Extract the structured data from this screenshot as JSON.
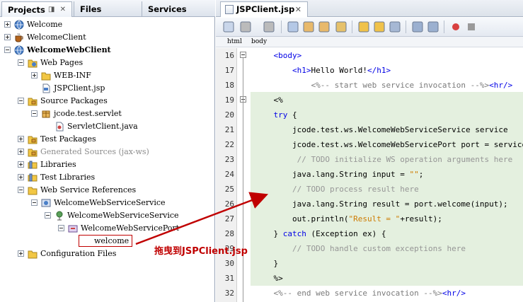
{
  "projects_panel": {
    "tabs": [
      "Projects",
      "Files",
      "Services"
    ],
    "tab_controls": "◨ ✕",
    "tree": [
      {
        "label": "Welcome",
        "icon": "globe-icon",
        "expanded": false,
        "bold": false
      },
      {
        "label": "WelcomeClient",
        "icon": "coffee-cup-icon",
        "expanded": false,
        "bold": false
      },
      {
        "label": "WelcomeWebClient",
        "icon": "globe-icon",
        "expanded": true,
        "bold": true
      },
      {
        "label": "Web Pages",
        "icon": "web-folder-icon",
        "expanded": true,
        "bold": false
      },
      {
        "label": "WEB-INF",
        "icon": "folder-icon",
        "expanded": false,
        "bold": false
      },
      {
        "label": "JSPClient.jsp",
        "icon": "jsp-file-icon",
        "bold": false
      },
      {
        "label": "Source Packages",
        "icon": "package-folder-icon",
        "expanded": true,
        "bold": false
      },
      {
        "label": "jcode.test.servlet",
        "icon": "package-icon",
        "expanded": true,
        "bold": false
      },
      {
        "label": "ServletClient.java",
        "icon": "java-file-icon",
        "bold": false
      },
      {
        "label": "Test Packages",
        "icon": "package-folder-icon",
        "expanded": false,
        "bold": false
      },
      {
        "label": "Generated Sources (jax-ws)",
        "icon": "package-folder-icon",
        "expanded": false,
        "bold": false,
        "grey": true
      },
      {
        "label": "Libraries",
        "icon": "library-icon",
        "expanded": false,
        "bold": false
      },
      {
        "label": "Test Libraries",
        "icon": "library-icon",
        "expanded": false,
        "bold": false
      },
      {
        "label": "Web Service References",
        "icon": "folder-icon",
        "expanded": true,
        "bold": false
      },
      {
        "label": "WelcomeWebServiceService",
        "icon": "web-service-icon",
        "expanded": true,
        "bold": false
      },
      {
        "label": "WelcomeWebServiceService",
        "icon": "service-icon",
        "expanded": true,
        "bold": false
      },
      {
        "label": "WelcomeWebServicePort",
        "icon": "port-icon",
        "expanded": true,
        "bold": false
      },
      {
        "label": "welcome",
        "icon": "operation-icon",
        "bold": false,
        "selected": true
      },
      {
        "label": "Configuration Files",
        "icon": "folder-icon",
        "expanded": false,
        "bold": false
      }
    ]
  },
  "editor": {
    "tab_label": "JSPClient.jsp",
    "close_glyph": "✕",
    "breadcrumbs": [
      "html",
      "body"
    ],
    "lines": [
      {
        "num": "16",
        "fold": true,
        "segments": [
          {
            "t": "    "
          },
          {
            "t": "<body>",
            "c": "#0000e6"
          }
        ]
      },
      {
        "num": "17",
        "segments": [
          {
            "t": "        "
          },
          {
            "t": "<h1>",
            "c": "#0000e6"
          },
          {
            "t": "Hello World!"
          },
          {
            "t": "</h1>",
            "c": "#0000e6"
          }
        ]
      },
      {
        "num": "18",
        "segments": [
          {
            "t": "            "
          },
          {
            "t": "<%-- start web service invocation --%>",
            "c": "#7a7a7a"
          },
          {
            "t": "<hr/>",
            "c": "#0000e6"
          }
        ]
      },
      {
        "num": "19",
        "fold": true,
        "segments": [
          {
            "t": "    "
          },
          {
            "t": "<%",
            "c": "#000"
          }
        ]
      },
      {
        "num": "20",
        "segments": [
          {
            "t": "    "
          },
          {
            "t": "try",
            "c": "#0000e6"
          },
          {
            "t": " {"
          }
        ]
      },
      {
        "num": "21",
        "segments": [
          {
            "t": "        jcode.test.ws.WelcomeWebServiceService service"
          }
        ]
      },
      {
        "num": "22",
        "segments": [
          {
            "t": "        jcode.test.ws.WelcomeWebServicePort port = service."
          }
        ]
      },
      {
        "num": "23",
        "segments": [
          {
            "t": "         "
          },
          {
            "t": "// TODO initialize WS operation arguments here",
            "c": "#969696"
          }
        ]
      },
      {
        "num": "24",
        "segments": [
          {
            "t": "        java.lang.String input = "
          },
          {
            "t": "\"\"",
            "c": "#ce7b00"
          },
          {
            "t": ";"
          }
        ]
      },
      {
        "num": "25",
        "segments": [
          {
            "t": "        "
          },
          {
            "t": "// TODO process result here",
            "c": "#969696"
          }
        ]
      },
      {
        "num": "26",
        "segments": [
          {
            "t": "        java.lang.String result = port.welcome(input);"
          }
        ]
      },
      {
        "num": "27",
        "segments": [
          {
            "t": "        out.println("
          },
          {
            "t": "\"Result = \"",
            "c": "#ce7b00"
          },
          {
            "t": "+result);"
          }
        ]
      },
      {
        "num": "28",
        "segments": [
          {
            "t": "    } "
          },
          {
            "t": "catch",
            "c": "#0000e6"
          },
          {
            "t": " (Exception ex) {"
          }
        ]
      },
      {
        "num": "29",
        "segments": [
          {
            "t": "        "
          },
          {
            "t": "// TODO handle custom exceptions here",
            "c": "#969696"
          }
        ]
      },
      {
        "num": "30",
        "segments": [
          {
            "t": "    }"
          }
        ]
      },
      {
        "num": "31",
        "segments": [
          {
            "t": "    %>"
          }
        ]
      },
      {
        "num": "32",
        "segments": [
          {
            "t": "    "
          },
          {
            "t": "<%-- end web service invocation --%>",
            "c": "#7a7a7a"
          },
          {
            "t": "<hr/>",
            "c": "#0000e6"
          }
        ]
      }
    ]
  },
  "annotation": {
    "text": "拖曳到JSPClient.jsp",
    "color": "#c00000"
  }
}
